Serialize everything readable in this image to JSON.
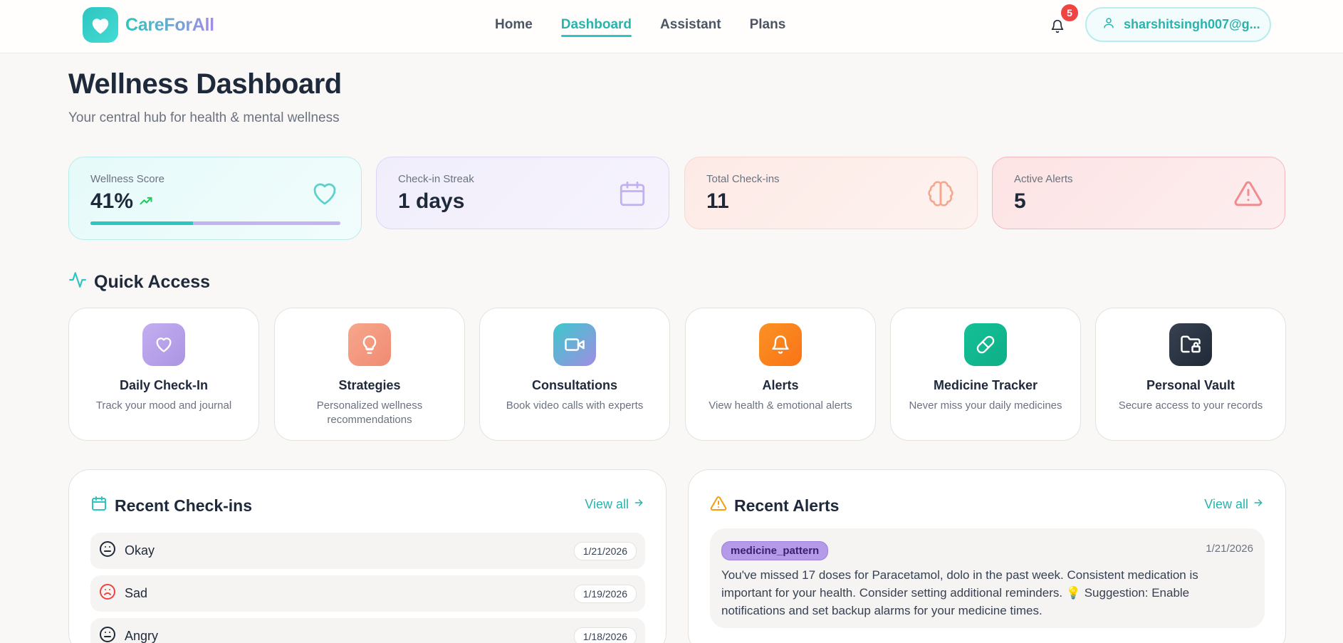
{
  "nav": {
    "brand": "CareForAll",
    "links": [
      {
        "label": "Home",
        "active": false
      },
      {
        "label": "Dashboard",
        "active": true
      },
      {
        "label": "Assistant",
        "active": false
      },
      {
        "label": "Plans",
        "active": false
      }
    ],
    "notification_count": "5",
    "user_email": "sharshitsingh007@g..."
  },
  "header": {
    "title": "Wellness Dashboard",
    "subtitle": "Your central hub for health & mental wellness"
  },
  "stats": [
    {
      "label": "Wellness Score",
      "value": "41%",
      "progress": 0.41,
      "icon": "heart-icon"
    },
    {
      "label": "Check-in Streak",
      "value": "1 days",
      "icon": "calendar-icon"
    },
    {
      "label": "Total Check-ins",
      "value": "11",
      "icon": "brain-icon"
    },
    {
      "label": "Active Alerts",
      "value": "5",
      "icon": "alert-triangle-icon"
    }
  ],
  "quick_access": {
    "title": "Quick Access",
    "items": [
      {
        "name": "Daily Check-In",
        "desc": "Track your mood and journal",
        "icon": "heart-icon",
        "color": "#b9a2ea"
      },
      {
        "name": "Strategies",
        "desc": "Personalized wellness recommendations",
        "icon": "lightbulb-icon",
        "color": "#f19a80"
      },
      {
        "name": "Consultations",
        "desc": "Book video calls with experts",
        "icon": "video-icon",
        "color": "#45c2cf"
      },
      {
        "name": "Alerts",
        "desc": "View health & emotional alerts",
        "icon": "bell-icon",
        "color": "#fb8417"
      },
      {
        "name": "Medicine Tracker",
        "desc": "Never miss your daily medicines",
        "icon": "pill-icon",
        "color": "#12b98f"
      },
      {
        "name": "Personal Vault",
        "desc": "Secure access to your records",
        "icon": "folder-lock-icon",
        "color": "#2e3746"
      }
    ]
  },
  "recent_checkins": {
    "title": "Recent Check-ins",
    "view_all": "View all",
    "items": [
      {
        "mood": "Okay",
        "date": "1/21/2026"
      },
      {
        "mood": "Sad",
        "date": "1/19/2026"
      },
      {
        "mood": "Angry",
        "date": "1/18/2026"
      }
    ]
  },
  "recent_alerts": {
    "title": "Recent Alerts",
    "view_all": "View all",
    "items": [
      {
        "tag": "medicine_pattern",
        "date": "1/21/2026",
        "message": "You've missed 17 doses for Paracetamol, dolo in the past week. Consistent medication is important for your health. Consider setting additional reminders. 💡 Suggestion: Enable notifications and set backup alarms for your medicine times."
      }
    ]
  }
}
